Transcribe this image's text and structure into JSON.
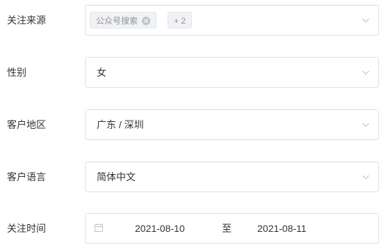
{
  "form": {
    "follow_source": {
      "label": "关注来源",
      "tags": [
        "公众号搜索"
      ],
      "collapsed_count": "+ 2"
    },
    "gender": {
      "label": "性别",
      "value": "女"
    },
    "region": {
      "label": "客户地区",
      "value": "广东 / 深圳"
    },
    "language": {
      "label": "客户语言",
      "value": "简体中文"
    },
    "follow_time": {
      "label": "关注时间",
      "start": "2021-08-10",
      "separator": "至",
      "end": "2021-08-11"
    }
  },
  "icons": {
    "dropdown": "chevron-down-icon",
    "tag_close": "close-icon",
    "date": "calendar-icon"
  },
  "colors": {
    "border": "#dcdfe6",
    "label": "#333333",
    "tag_bg": "#f0f2f5",
    "tag_text": "#909399",
    "icon": "#c0c4cc"
  }
}
